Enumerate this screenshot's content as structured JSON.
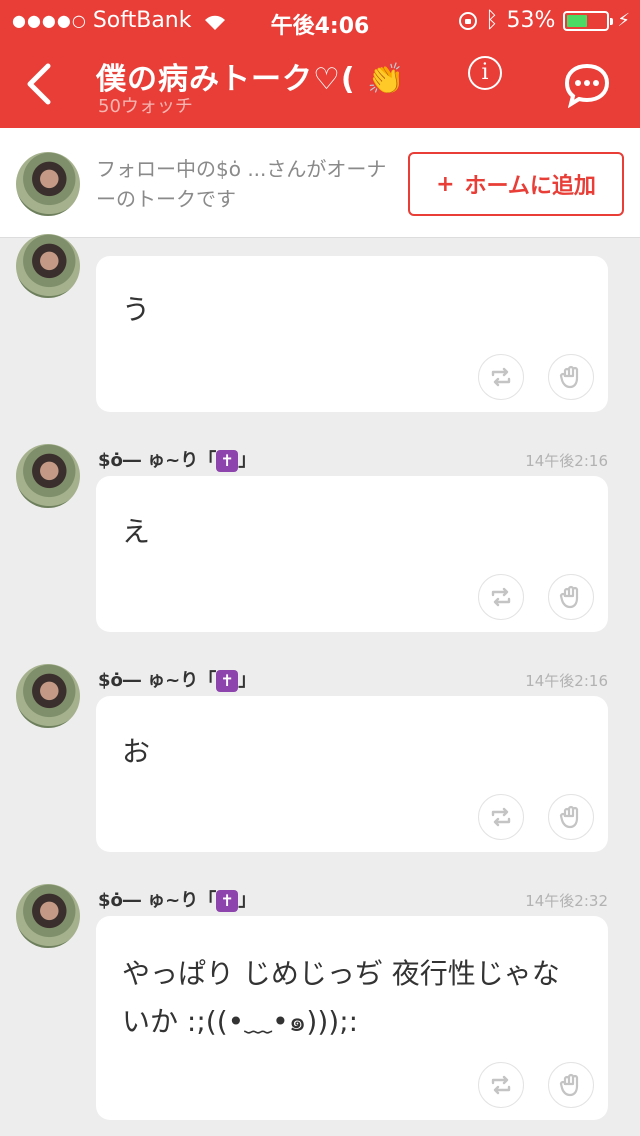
{
  "status_bar": {
    "carrier": "SoftBank",
    "signal_dots": "●●●●○",
    "time": "午後4:06",
    "battery_percent": "53%",
    "battery_level": 0.53
  },
  "nav": {
    "title": "僕の病みトーク♡( 👏",
    "subtitle": "50ウォッチ"
  },
  "banner": {
    "text": "フォロー中の$ȯ ...さんがオーナーのトークです",
    "add_home_label": "ホームに追加",
    "add_home_plus": "+"
  },
  "messages": [
    {
      "author": "",
      "time": "14午後2:16",
      "text": "う"
    },
    {
      "author": "$ȯ― ゅ~り「",
      "author_suffix": "」",
      "time": "14午後2:16",
      "text": "え"
    },
    {
      "author": "$ȯ― ゅ~り「",
      "author_suffix": "」",
      "time": "14午後2:16",
      "text": "お"
    },
    {
      "author": "$ȯ― ゅ~り「",
      "author_suffix": "」",
      "time": "14午後2:32",
      "text": "やっぱり じめじっぢ 夜行性じゃないか :;((•﹏•๑)));:"
    }
  ],
  "colors": {
    "accent": "#e83e37",
    "background": "#ededed",
    "cross_badge": "#8e44ad"
  },
  "icons": {
    "back": "chevron-left-icon",
    "info": "info-icon",
    "chat": "chat-bubble-icon",
    "repost": "repost-icon",
    "glove": "glove-icon"
  }
}
